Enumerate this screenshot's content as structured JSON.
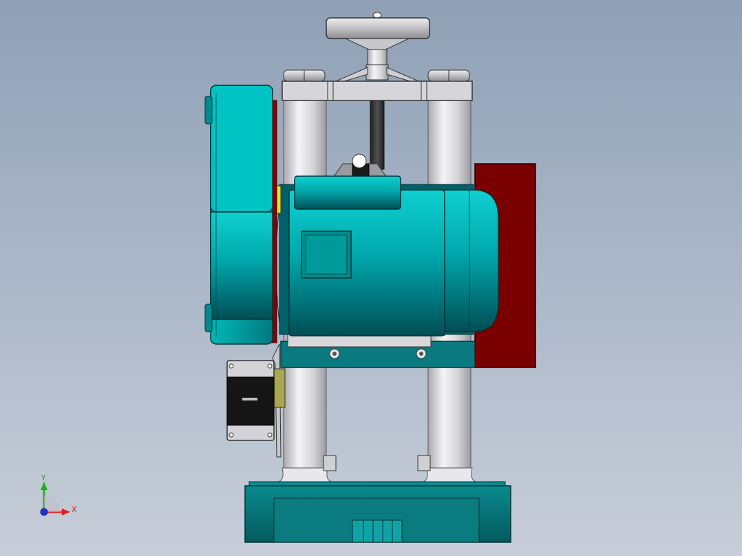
{
  "view": {
    "background_top": "#8fa0b6",
    "background_bottom": "#c7ced9"
  },
  "triad": {
    "x_label": "X",
    "y_label": "Y",
    "x_color": "#e02020",
    "y_color": "#20b020",
    "z_color": "#2030d0"
  },
  "model": {
    "teal": "#00b4b4",
    "teal_dark": "#006a6e",
    "red_panel": "#7a0000",
    "steel": "#d8d8dc",
    "motor_badge": "#008c8c"
  }
}
